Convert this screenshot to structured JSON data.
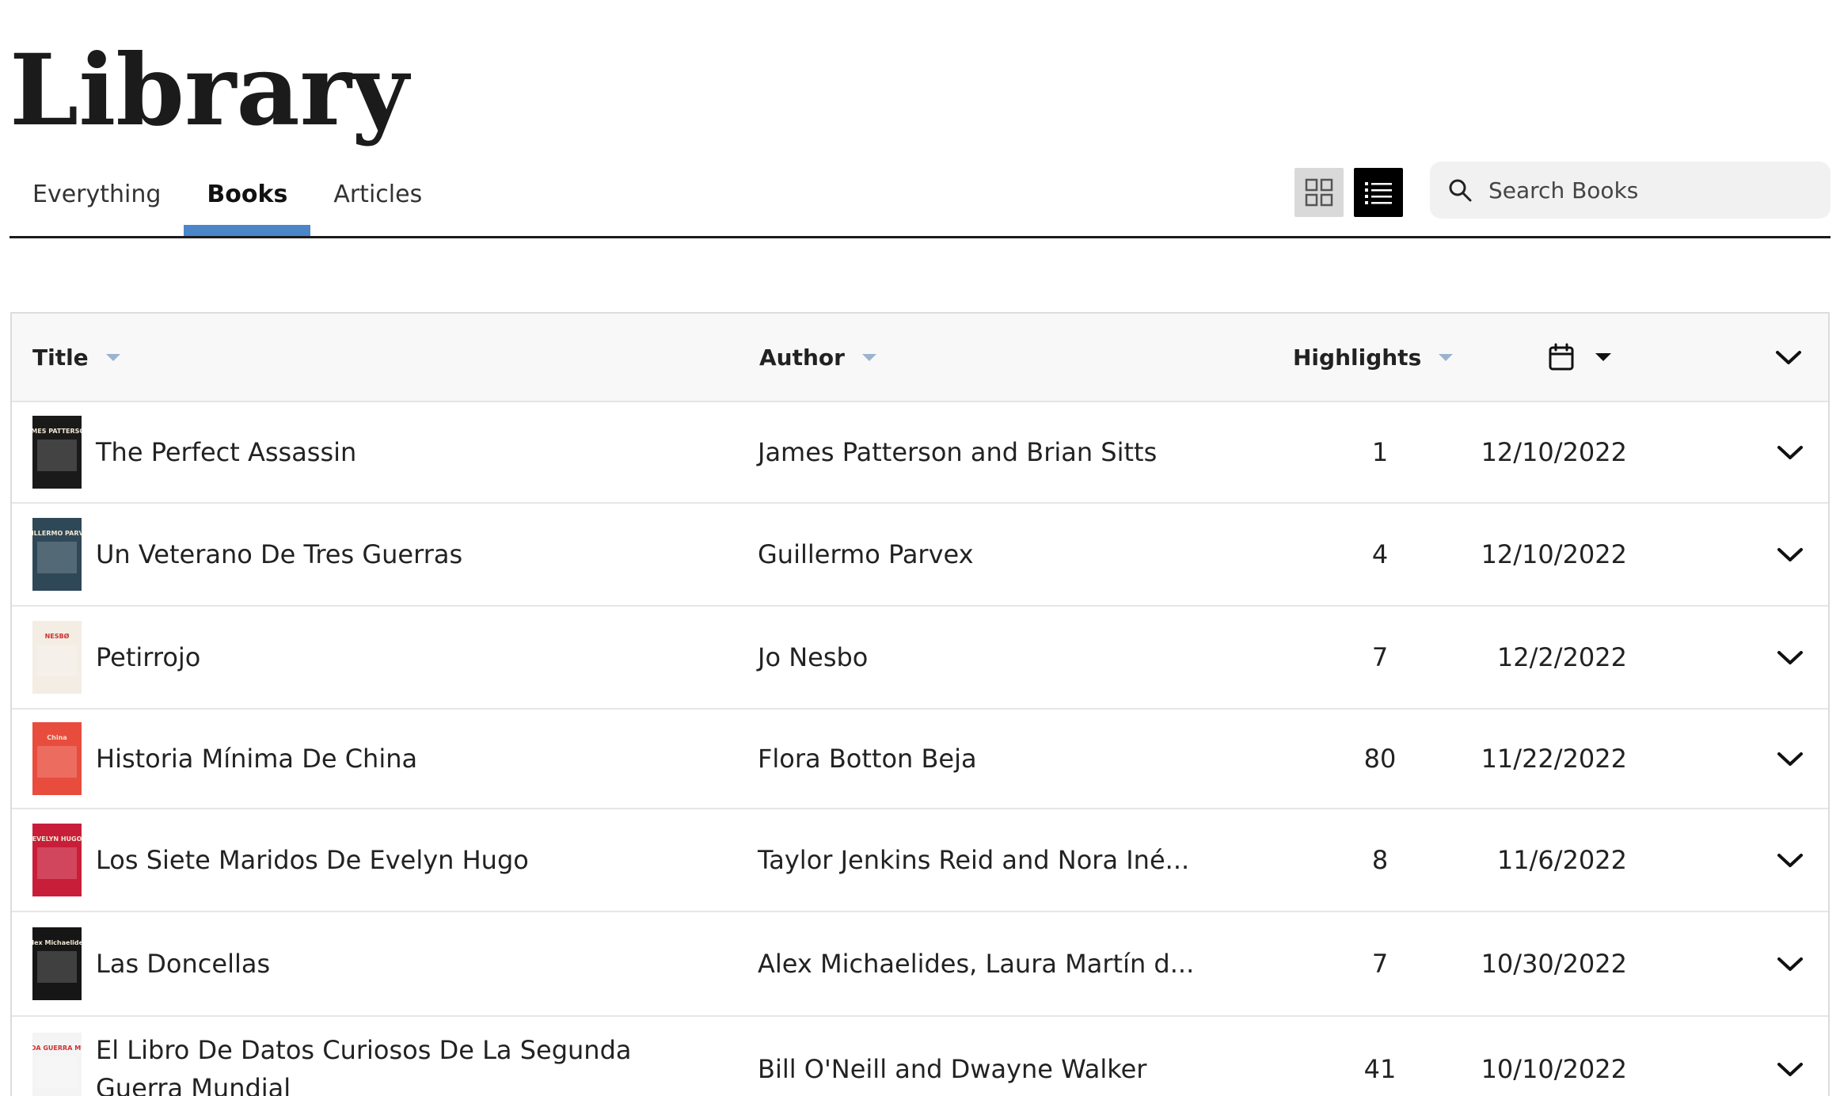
{
  "header": {
    "title": "Library"
  },
  "tabs": [
    {
      "label": "Everything",
      "active": false
    },
    {
      "label": "Books",
      "active": true
    },
    {
      "label": "Articles",
      "active": false
    }
  ],
  "view_toggle": {
    "grid_icon": "grid-icon",
    "list_icon": "list-icon",
    "active": "list"
  },
  "search": {
    "placeholder": "Search Books"
  },
  "table": {
    "columns": {
      "title": "Title",
      "author": "Author",
      "highlights": "Highlights"
    },
    "rows": [
      {
        "title": "The Perfect Assassin",
        "author": "James Patterson and Brian Sitts",
        "highlights": "1",
        "date": "12/10/2022",
        "cover_color": "#1a1a1a",
        "cover_text": "JAMES PATTERSON"
      },
      {
        "title": "Un Veterano De Tres Guerras",
        "author": "Guillermo Parvex",
        "highlights": "4",
        "date": "12/10/2022",
        "cover_color": "#2f4858",
        "cover_text": "GUILLERMO PARVEX"
      },
      {
        "title": "Petirrojo",
        "author": "Jo Nesbo",
        "highlights": "7",
        "date": "12/2/2022",
        "cover_color": "#f3ede4",
        "cover_text": "NESBØ"
      },
      {
        "title": "Historia Mínima De China",
        "author": "Flora Botton Beja",
        "highlights": "80",
        "date": "11/22/2022",
        "cover_color": "#e84c3d",
        "cover_text": "China"
      },
      {
        "title": "Los Siete Maridos De Evelyn Hugo",
        "author": "Taylor Jenkins Reid and Nora Iné...",
        "highlights": "8",
        "date": "11/6/2022",
        "cover_color": "#c81e3a",
        "cover_text": "EVELYN HUGO"
      },
      {
        "title": "Las Doncellas",
        "author": "Alex Michaelides, Laura Martín d...",
        "highlights": "7",
        "date": "10/30/2022",
        "cover_color": "#161616",
        "cover_text": "Alex Michaelides"
      },
      {
        "title": "El Libro De Datos Curiosos De La Segunda Guerra Mundial",
        "author": "Bill O'Neill and Dwayne Walker",
        "highlights": "41",
        "date": "10/10/2022",
        "cover_color": "#f4f4f4",
        "cover_text": "SEGUNDA GUERRA MUNDIAL"
      }
    ]
  }
}
